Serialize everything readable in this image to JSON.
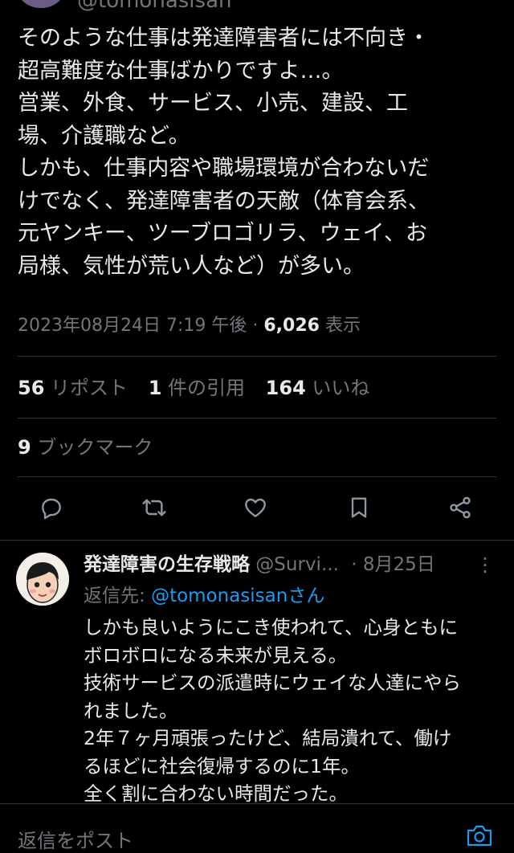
{
  "header": {
    "handle": "@tomonasisan"
  },
  "tweet": {
    "lines": [
      "そのような仕事は発達障害者には不向き・",
      "超高難度な仕事ばかりですよ…。",
      "営業、外食、サービス、小売、建設、工",
      "場、介護職など。",
      "しかも、仕事内容や職場環境が合わないだ",
      "けでなく、発達障害者の天敵（体育会系、",
      "元ヤンキー、ツーブロゴリラ、ウェイ、お",
      "局様、気性が荒い人など）が多い。"
    ],
    "timestamp": "2023年08月24日 7:19 午後 · ",
    "views_count": "6,026",
    "views_label": " 表示"
  },
  "stats": {
    "reposts_count": "56",
    "reposts_label": " リポスト",
    "quotes_count": "1",
    "quotes_label": " 件の引用",
    "likes_count": "164",
    "likes_label": " いいね",
    "bookmarks_count": "9",
    "bookmarks_label": " ブックマーク"
  },
  "actions": [
    "reply-icon",
    "repost-icon",
    "like-icon",
    "bookmark-icon",
    "share-icon"
  ],
  "reply": {
    "name": "発達障害の生存戦略",
    "handle": " @Survi...",
    "date": " · 8月25日",
    "more": "⋮",
    "replying_prefix": "返信先: ",
    "replying_to": "@tomonasisanさん",
    "lines": [
      "しかも良いようにこき使われて、心身ともに",
      "ボロボロになる未来が見える。",
      "技術サービスの派遣時にウェイな人達にやら",
      "れました。",
      "2年７ヶ月頑張ったけど、結局潰れて、働け",
      "るほどに社会復帰するのに1年。",
      "全く割に合わない時間だった。"
    ]
  },
  "composer": {
    "placeholder": "返信をポスト"
  },
  "colors": {
    "background": "#000000",
    "text": "#e7e9ea",
    "muted": "#71767b",
    "link": "#1d9bf0",
    "divider": "#2f3336"
  }
}
